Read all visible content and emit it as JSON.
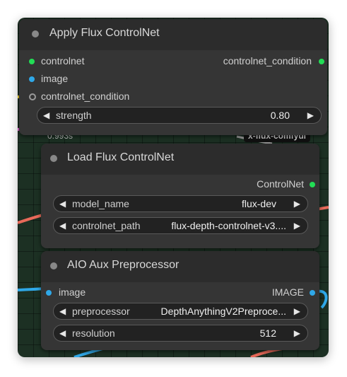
{
  "background_labels": {
    "time": "0.993s",
    "badge": "x-flux-comfyui"
  },
  "apply_node": {
    "title": "Apply Flux ControlNet",
    "inputs": [
      {
        "label": "controlnet",
        "color": "#22dd55"
      },
      {
        "label": "image",
        "color": "#2fa8e8"
      },
      {
        "label": "controlnet_condition",
        "color": "#9a9a9a"
      }
    ],
    "output": {
      "label": "controlnet_condition",
      "color": "#22dd55"
    },
    "widgets": [
      {
        "name": "strength",
        "value": "0.80"
      }
    ]
  },
  "load_node": {
    "title": "Load Flux ControlNet",
    "output": {
      "label": "ControlNet",
      "color": "#22dd55"
    },
    "widgets": [
      {
        "name": "model_name",
        "value": "flux-dev"
      },
      {
        "name": "controlnet_path",
        "value": "flux-depth-controlnet-v3...."
      }
    ]
  },
  "aio_node": {
    "title": "AIO Aux Preprocessor",
    "input": {
      "label": "image",
      "color": "#2fa8e8"
    },
    "output": {
      "label": "IMAGE",
      "color": "#2fa8e8"
    },
    "widgets": [
      {
        "name": "preprocessor",
        "value": "DepthAnythingV2Preproce..."
      },
      {
        "name": "resolution",
        "value": "512"
      }
    ]
  },
  "colors": {
    "canvas_bg": "#1c3023",
    "node_body": "#353535",
    "node_title": "#2c2c2c",
    "wire_yellow": "#e8c82a",
    "wire_pink": "#e060d0",
    "wire_salmon": "#e86a5a",
    "wire_blue": "#2fa8e8"
  },
  "icons": {
    "arrow_left": "◀",
    "arrow_right": "▶"
  }
}
